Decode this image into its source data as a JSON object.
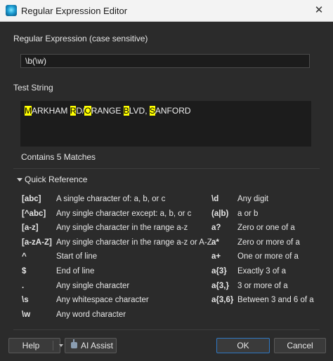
{
  "window": {
    "title": "Regular Expression Editor",
    "close_glyph": "✕"
  },
  "regex": {
    "label": "Regular Expression (case sensitive)",
    "value": "\\b(\\w)"
  },
  "test": {
    "label": "Test String",
    "segments": [
      {
        "text": "M",
        "match": true
      },
      {
        "text": "ARKHAM ",
        "match": false
      },
      {
        "text": "R",
        "match": true
      },
      {
        "text": "D/",
        "match": false
      },
      {
        "text": "O",
        "match": true
      },
      {
        "text": "RANGE ",
        "match": false
      },
      {
        "text": "B",
        "match": true
      },
      {
        "text": "LVD, ",
        "match": false
      },
      {
        "text": "S",
        "match": true
      },
      {
        "text": "ANFORD",
        "match": false
      }
    ],
    "match_count": "Contains 5 Matches",
    "highlight_color": "#ffff00"
  },
  "quick_reference": {
    "title": "Quick Reference",
    "left": [
      {
        "token": "[abc]",
        "desc": "A single character of: a, b, or c"
      },
      {
        "token": "[^abc]",
        "desc": "Any single character except: a, b, or c"
      },
      {
        "token": "[a-z]",
        "desc": "Any single character in the range a-z"
      },
      {
        "token": "[a-zA-Z]",
        "desc": "Any single character in the range a-z or A-Z"
      },
      {
        "token": "^",
        "desc": "Start of line"
      },
      {
        "token": "$",
        "desc": "End of line"
      },
      {
        "token": ".",
        "desc": "Any single character"
      },
      {
        "token": "\\s",
        "desc": "Any whitespace character"
      },
      {
        "token": "\\w",
        "desc": "Any word character"
      }
    ],
    "right": [
      {
        "token": "\\d",
        "desc": "Any digit"
      },
      {
        "token": "(a|b)",
        "desc": "a or b"
      },
      {
        "token": "a?",
        "desc": "Zero or one of a"
      },
      {
        "token": "a*",
        "desc": "Zero or more of a"
      },
      {
        "token": "a+",
        "desc": "One or more of a"
      },
      {
        "token": "a{3}",
        "desc": "Exactly 3 of a"
      },
      {
        "token": "a{3,}",
        "desc": "3 or more of a"
      },
      {
        "token": "a{3,6}",
        "desc": "Between 3 and 6 of a"
      }
    ]
  },
  "buttons": {
    "help": "Help",
    "ai_assist": "AI Assist",
    "ok": "OK",
    "cancel": "Cancel"
  },
  "colors": {
    "accent": "#2f78c4",
    "background": "#2b2b2b"
  },
  "icons": {
    "app": "regex-app-icon",
    "ai": "robot-icon",
    "collapse": "triangle-down-icon"
  }
}
